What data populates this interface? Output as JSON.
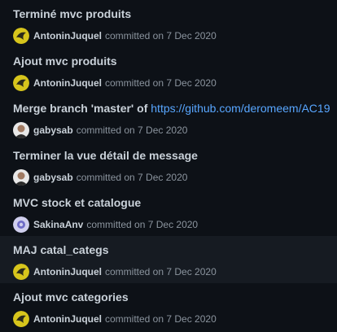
{
  "commits": [
    {
      "title": "Terminé mvc produits",
      "author": "AntoninJuquel",
      "meta": "committed on 7 Dec 2020",
      "avatar": "yellow-logo-avatar"
    },
    {
      "title": "Ajout mvc produits",
      "author": "AntoninJuquel",
      "meta": "committed on 7 Dec 2020",
      "avatar": "yellow-logo-avatar"
    },
    {
      "title": "Merge branch 'master' of",
      "title_link": "https://github.com/deromeem/AC19",
      "author": "gabysab",
      "meta": "committed on 7 Dec 2020",
      "avatar": "person-avatar"
    },
    {
      "title": "Terminer la vue détail de message",
      "author": "gabysab",
      "meta": "committed on 7 Dec 2020",
      "avatar": "person-avatar"
    },
    {
      "title": "MVC stock et catalogue",
      "author": "SakinaAnv",
      "meta": "committed on 7 Dec 2020",
      "avatar": "identicon-avatar"
    },
    {
      "title": "MAJ catal_categs",
      "author": "AntoninJuquel",
      "meta": "committed on 7 Dec 2020",
      "avatar": "yellow-logo-avatar"
    },
    {
      "title": "Ajout mvc categories",
      "author": "AntoninJuquel",
      "meta": "committed on 7 Dec 2020",
      "avatar": "yellow-logo-avatar"
    }
  ],
  "colors": {
    "background": "#0d1117",
    "hover": "#161b22",
    "link": "#58a6ff",
    "muted": "#8b949e",
    "text": "#c9d1d9"
  }
}
